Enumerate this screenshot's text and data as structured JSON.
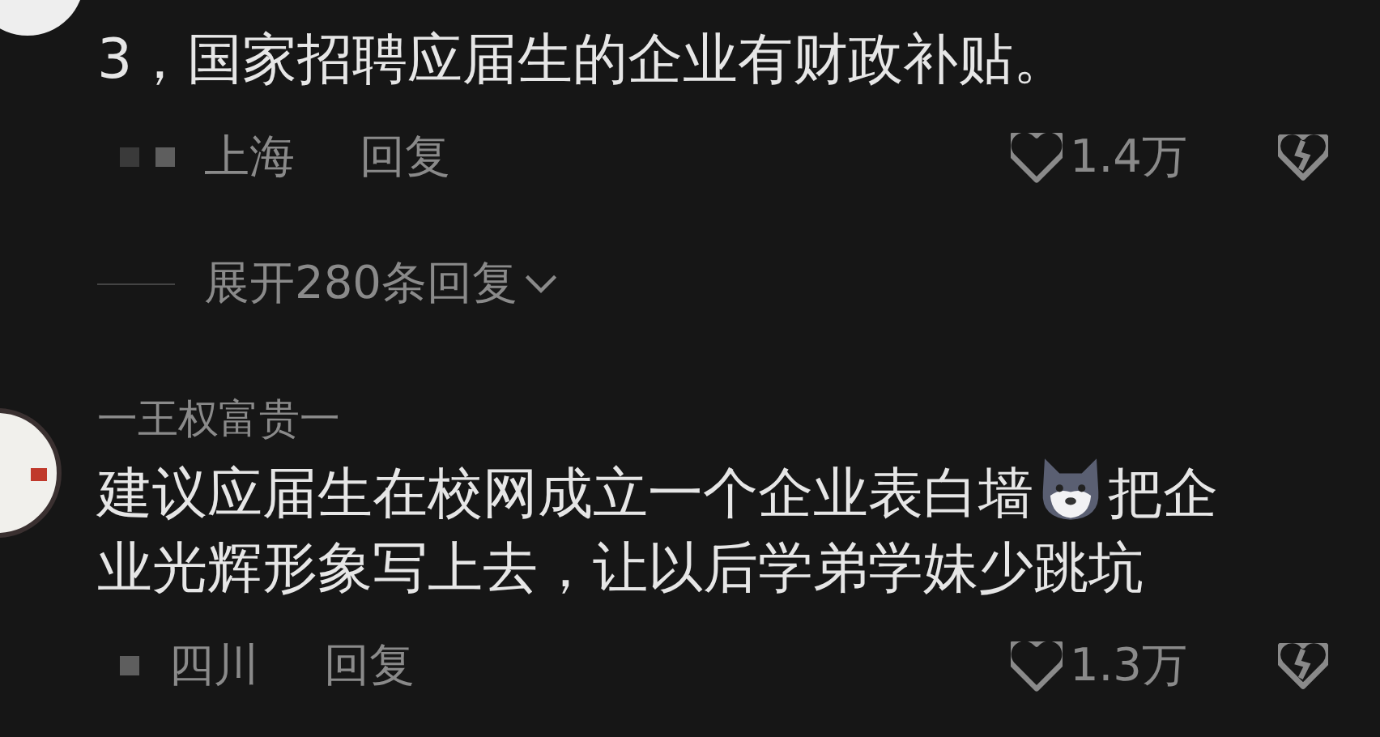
{
  "comments": [
    {
      "kind": "continued",
      "lines": [
        [
          {
            "kind": "text",
            "text": "3，国家招聘应届生的企业有财政补贴。"
          }
        ]
      ],
      "date_marks": [
        {
          "kind": "faint"
        },
        {
          "kind": "solid"
        }
      ],
      "location": "上海",
      "reply": "回复",
      "likes": "1.4万",
      "replies_toggle": "展开280条回复"
    },
    {
      "kind": "full",
      "username": "一王权富贵一",
      "lines": [
        [
          {
            "kind": "text",
            "text": "建议应届生在校网成立一个企业表白墙"
          },
          {
            "kind": "emoji"
          },
          {
            "kind": "text",
            "text": "把企"
          }
        ],
        [
          {
            "kind": "text",
            "text": "业光辉形象写上去，让以后学弟学妹少跳坑"
          }
        ]
      ],
      "date_marks": [
        {
          "kind": "solid"
        }
      ],
      "location": "四川",
      "reply": "回复",
      "likes": "1.3万"
    }
  ]
}
